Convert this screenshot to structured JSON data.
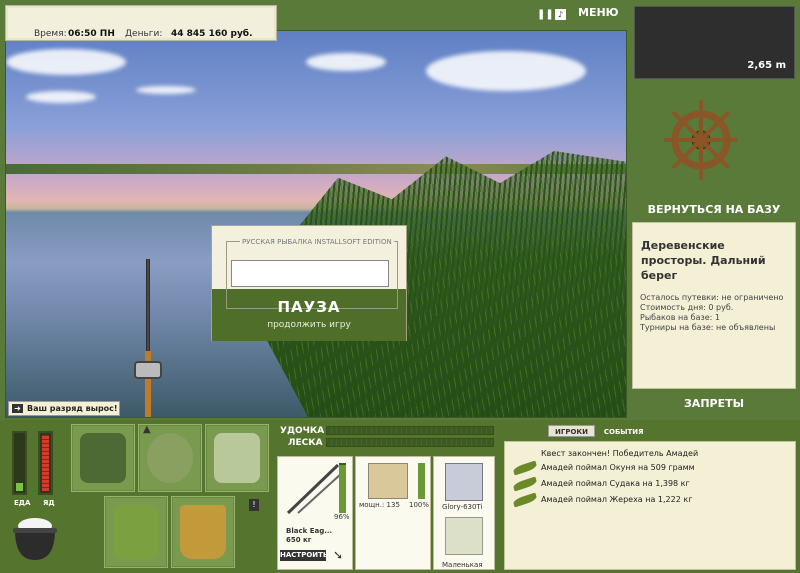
{
  "header": {
    "time_label": "Время:",
    "time_value": "06:50 ПН",
    "money_label": "Деньги:",
    "money_value": "44 845 160 руб.",
    "menu_label": "МЕНЮ"
  },
  "depth": {
    "value": "2,65 m"
  },
  "base": {
    "return_label": "ВЕРНУТЬСЯ НА БАЗУ",
    "location_title": "Деревенские просторы. Дальний берег",
    "rows": [
      "Осталось путевки: не ограничено",
      "Стоимость дня: 0 руб.",
      "Рыбаков на базе: 1",
      "Турниры на базе: не объявлены"
    ],
    "bans_label": "ЗАПРЕТЫ"
  },
  "pause_dialog": {
    "caption": "РУССКАЯ РЫБАЛКА INSTALLSOFT EDITION",
    "pause_label": "ПАУЗА",
    "continue_label": "продолжить игру"
  },
  "notification": {
    "icon": "arrow-right-icon",
    "text": "Ваш разряд вырос!"
  },
  "meters": {
    "food_label": "ЕДА",
    "poison_label": "ЯД",
    "food_level": 0.15,
    "poison_level": 1.0,
    "food_color": "#7ac242",
    "poison_color": "#d63a2a"
  },
  "tackle": {
    "rod_label": "УДОЧКА",
    "line_label": "ЛЕСКА",
    "rod_name": "Black Eag...",
    "rod_weight": "650 кг",
    "rod_percent": "96%",
    "reel_name": "мощн.: 135",
    "reel_percent": "100%",
    "line_name": "Glory-630Ti",
    "lure_name": "Маленькая",
    "setup_label": "НАСТРОИТЬ"
  },
  "log": {
    "tabs": [
      "ИГРОКИ",
      "СОБЫТИЯ"
    ],
    "active_tab": "ИГРОКИ",
    "entries": [
      "Квест закончен! Победитель Амадей",
      "Амадей поймал Окуня на 509 грамм",
      "Амадей поймал Судака на 1,398 кг",
      "Амадей поймал Жереха на 1,222 кг"
    ]
  },
  "colors": {
    "panel_green": "#5a7a3a",
    "panel_cream": "#f3f0d6"
  }
}
